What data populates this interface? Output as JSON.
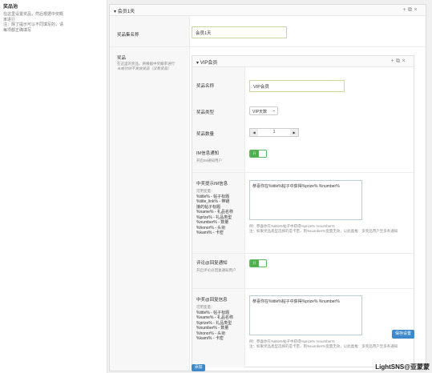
{
  "left": {
    "title": "奖品池",
    "desc": "在这里设置奖品，然后根据中奖概率进行",
    "desc2": "注：除了提示可以不同填写的，请每项都正确填写"
  },
  "outer": {
    "title": "会员1天",
    "tools": [
      "+",
      "⧉",
      "×"
    ],
    "set_name_label": "奖品集名称",
    "set_name_value": "会员1天",
    "prize_label": "奖品",
    "prize_desc": "在这里的奖品，将根据中奖概率进行",
    "prize_desc_italic": "未成功则不发放奖品（没有奖品）"
  },
  "inner": {
    "title": "VIP会员",
    "tools": [
      "+",
      "⧉",
      "×"
    ],
    "name_label": "奖品名称",
    "name_value": "VIP会员",
    "type_label": "奖品类型",
    "type_value": "VIP天数",
    "count_label": "奖品数量",
    "count_value": "1",
    "im_label": "IM信息通知",
    "im_hint": "开启IM通知用户",
    "toggle_on": "开",
    "msg_label": "中奖提示IM信息",
    "vars_title": "可用变量：",
    "vars": [
      "%title% - 帖子标题",
      "%title_link% - 带链",
      "接的帖子标题",
      "%name% - 礼品名称",
      "%prize% - 礼品类型",
      "%number% - 数量",
      "%honor% - 头衔",
      "%kami% - 卡密"
    ],
    "msg_value": "恭喜你在%title%帖子中获得%prize% %number%",
    "msg_example": "例：恭喜你在%title%帖子中获得%prize% %number%",
    "msg_note": "注：如果奖品类型选择的是卡密，则%number%变量无效，以此类推：多奖品用户至多条通知",
    "reply_label": "评论@回复通知",
    "reply_hint": "开启评论@回复通知用户",
    "reply_msg_label": "中奖@回复信息",
    "reply_vars": [
      "%title% - 帖子标题",
      "%name% - 礼品名称",
      "%prize% - 礼品类型",
      "%number% - 数量",
      "%honor% - 头衔",
      "%kami% - 卡密"
    ],
    "reply_msg_value": "恭喜你在%title%帖子中获得%prize% %number%",
    "reply_example": "例：恭喜你在%title%帖子中获得%prize% %number%",
    "reply_note": "注：如果奖品类型选择的是卡密，则%number%变量无效，以此类推：多奖品用户至多条通知",
    "save_label": "保存设置"
  },
  "add_label": "添加",
  "watermark": "LightSNS@亚蒙蒙"
}
